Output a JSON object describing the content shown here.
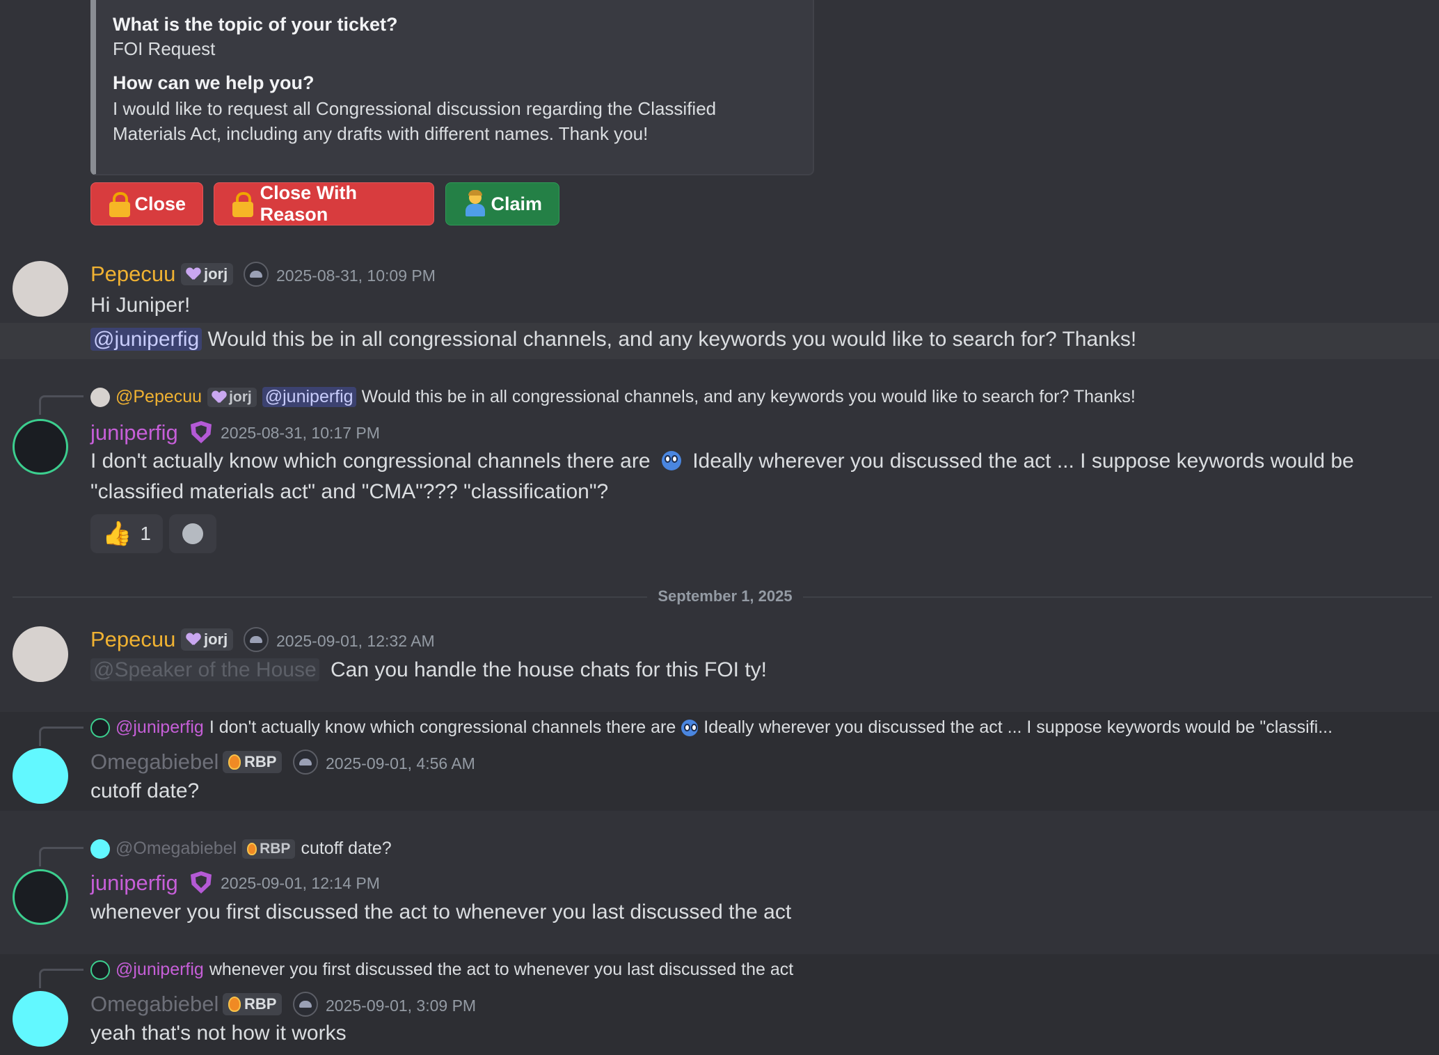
{
  "ticket_embed": {
    "q1": "What is the topic of your ticket?",
    "a1": "FOI Request",
    "q2": "How can we help you?",
    "a2_line1": "I would like to request all Congressional discussion regarding the Classified",
    "a2_line2": "Materials Act, including any drafts with different names. Thank you!"
  },
  "buttons": {
    "close": "Close",
    "close_reason": "Close With Reason",
    "claim": "Claim"
  },
  "messages": [
    {
      "author": "Pepecuu",
      "tag": "jorj",
      "timestamp": "2025-08-31, 10:09 PM",
      "line1": "Hi Juniper!",
      "mention": "@juniperfig",
      "line2": "Would this be in all congressional channels, and any keywords you would like to search for? Thanks!"
    },
    {
      "reply_author": "@Pepecuu",
      "reply_tag": "jorj",
      "reply_mention": "@juniperfig",
      "reply_text": "Would this be in all congressional channels, and any keywords you would like to search for? Thanks!",
      "author": "juniperfig",
      "timestamp": "2025-08-31, 10:17 PM",
      "line1a": "I don't actually know which congressional channels there are",
      "line1b": "Ideally wherever you discussed the act ... I suppose keywords would be",
      "line2": "\"classified materials act\" and \"CMA\"??? \"classification\"?",
      "reaction_count": "1"
    },
    {
      "author": "Pepecuu",
      "tag": "jorj",
      "timestamp": "2025-09-01, 12:32 AM",
      "mention": "@Speaker of the House",
      "text": "Can you handle the house chats for this FOI ty!"
    },
    {
      "reply_author": "@juniperfig",
      "reply_text_a": "I don't actually know which congressional channels there are",
      "reply_text_b": "Ideally wherever you discussed the act ... I suppose keywords would be \"classifi...",
      "author": "Omegabiebel",
      "tag": "RBP",
      "timestamp": "2025-09-01, 4:56 AM",
      "text": "cutoff date?"
    },
    {
      "reply_author": "@Omegabiebel",
      "reply_tag": "RBP",
      "reply_text": "cutoff date?",
      "author": "juniperfig",
      "timestamp": "2025-09-01, 12:14 PM",
      "text": "whenever you first discussed the act to whenever you last discussed the act"
    },
    {
      "reply_author": "@juniperfig",
      "reply_text": "whenever you first discussed the act to whenever you last discussed the act",
      "author": "Omegabiebel",
      "tag": "RBP",
      "timestamp": "2025-09-01, 3:09 PM",
      "text": "yeah that's not how it works"
    }
  ],
  "date_divider": "September 1, 2025",
  "colors": {
    "background": "#323339",
    "pepecuu": "#f0b232",
    "juniperfig": "#c65fd8",
    "omegabiebel": "#6d6f78",
    "danger_button": "#d83c3e",
    "success_button": "#248046"
  }
}
